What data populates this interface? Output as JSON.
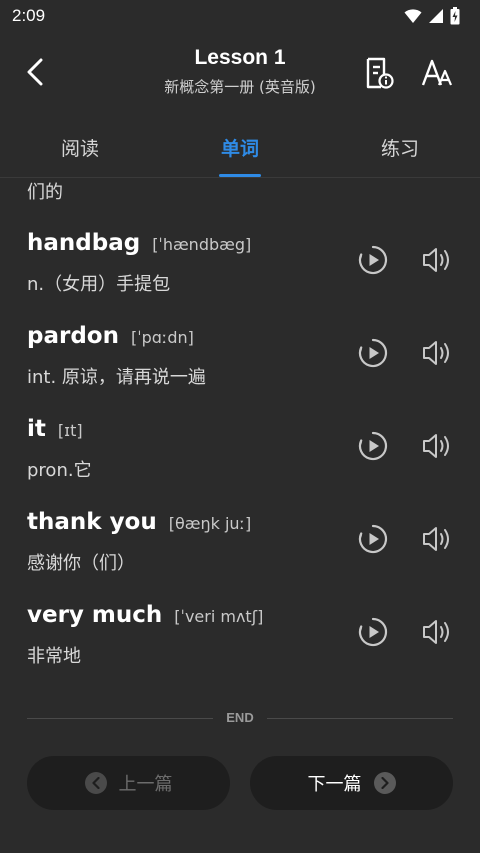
{
  "status": {
    "time": "2:09"
  },
  "header": {
    "title": "Lesson 1",
    "subtitle": "新概念第一册 (英音版)"
  },
  "tabs": [
    {
      "label": "阅读",
      "active": false
    },
    {
      "label": "单词",
      "active": true
    },
    {
      "label": "练习",
      "active": false
    }
  ],
  "partial_text": "们的",
  "words": [
    {
      "word": "handbag",
      "phonetic": "[ˈhændbæg]",
      "meaning": "n.（女用）手提包"
    },
    {
      "word": "pardon",
      "phonetic": "[ˈpɑːdn]",
      "meaning": "int. 原谅，请再说一遍"
    },
    {
      "word": "it",
      "phonetic": "[ɪt]",
      "meaning": "pron.它"
    },
    {
      "word": "thank you",
      "phonetic": "[θæŋk juː]",
      "meaning": "感谢你（们）"
    },
    {
      "word": "very much",
      "phonetic": "[ˈveri mʌtʃ]",
      "meaning": "非常地"
    }
  ],
  "end_label": "END",
  "nav": {
    "prev_label": "上一篇",
    "next_label": "下一篇"
  },
  "colors": {
    "accent": "#2f8be6",
    "background": "#2b2b2b",
    "button_bg": "#1e1e1e"
  }
}
